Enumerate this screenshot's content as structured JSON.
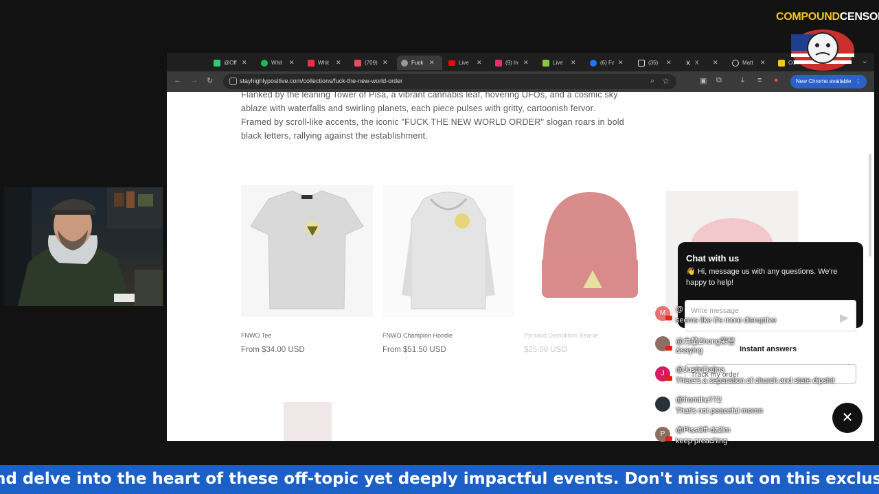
{
  "brand": {
    "logo_part1": "COMPOUND",
    "logo_part2": "CENSORED",
    "colors": {
      "logo_yellow": "#f5c518",
      "ticker_blue": "#1b5fc7",
      "chrome_update_blue": "#2b62c8"
    }
  },
  "browser": {
    "tabs": [
      {
        "label": "@Off",
        "icon": "green-square-icon",
        "color": "#2ecc71"
      },
      {
        "label": "Whit",
        "icon": "spotify-icon",
        "color": "#1db954"
      },
      {
        "label": "Whit",
        "icon": "music-icon",
        "color": "#fa2d48"
      },
      {
        "label": "(709)",
        "icon": "app-icon",
        "color": "#e84a5f"
      },
      {
        "label": "Fuck",
        "icon": "globe-icon",
        "color": "#999999",
        "active": true
      },
      {
        "label": "Live",
        "icon": "youtube-icon",
        "color": "#ff0000"
      },
      {
        "label": "(9) In",
        "icon": "instagram-icon",
        "color": "#e1306c"
      },
      {
        "label": "Live",
        "icon": "rumble-icon",
        "color": "#85c742"
      },
      {
        "label": "(6) Fa",
        "icon": "facebook-icon",
        "color": "#1877f2"
      },
      {
        "label": "(35)",
        "icon": "tiktok-icon",
        "color": "#ffffff"
      },
      {
        "label": "X",
        "icon": "x-icon",
        "color": "#ffffff"
      },
      {
        "label": "Matt",
        "icon": "threads-icon",
        "color": "#ffffff"
      },
      {
        "label": "COM",
        "icon": "page-icon",
        "color": "#f5c518"
      }
    ],
    "url": "stayhighlypositive.com/collections/fuck-the-new-world-order",
    "update_label": "New Chrome available"
  },
  "page": {
    "description": "Flanked by the leaning Tower of Pisa, a vibrant cannabis leaf, hovering UFOs, and a cosmic sky ablaze with waterfalls and swirling planets, each piece pulses with gritty, cartoonish fervor. Framed by scroll-like accents, the iconic \"FUCK THE NEW WORLD ORDER\" slogan roars in bold black letters, rallying against the establishment.",
    "products": [
      {
        "title": "FNWO Tee",
        "price": "From $34.00 USD"
      },
      {
        "title": "FNWO Champion Hoodie",
        "price": "From $51.50 USD"
      },
      {
        "title": "Pyramid Demolition Beanie",
        "price": "$25.00 USD"
      }
    ]
  },
  "chat_widget": {
    "title": "Chat with us",
    "subtitle": "👋 Hi, message us with any questions. We're happy to help!",
    "input_placeholder": "Write message",
    "instant_answers": "Instant answers",
    "track_order": "Track my order",
    "close_glyph": "✕"
  },
  "stream_chat": [
    {
      "user": "@",
      "text": "seems like it's more disruptive",
      "initial": "M",
      "color": "#e57373"
    },
    {
      "user": "@力量Zhong荣誉",
      "text": "&saying",
      "initial": "",
      "color": "#8d6e63"
    },
    {
      "user": "@JustinDajina",
      "text": "There's a separation of church and state dipshit",
      "initial": "J",
      "color": "#d81b60"
    },
    {
      "user": "@fromthe772",
      "text": "That's not peaceful moron",
      "initial": "",
      "color": "#263238"
    },
    {
      "user": "@PissOff-dz2lm",
      "text": "keep preaching",
      "initial": "P",
      "color": "#8d6e63"
    }
  ],
  "ticker": "nd delve into the heart of these off-topic yet deeply impactful events. Don't miss out on this exclusiv"
}
